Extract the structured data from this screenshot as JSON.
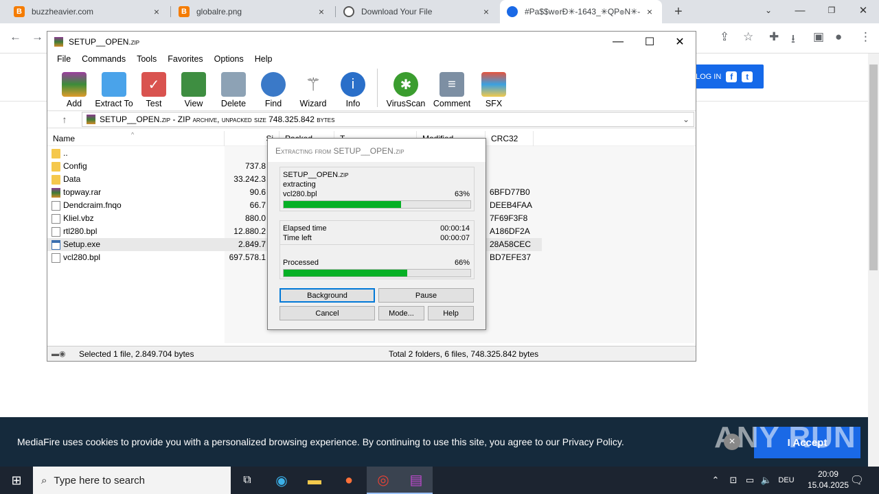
{
  "browser": {
    "tabs": [
      {
        "label": "buzzheavier.com",
        "favicon": "B",
        "color": "#f57c00"
      },
      {
        "label": "globalre.png",
        "favicon": "B",
        "color": "#f57c00"
      },
      {
        "label": "Download Your File",
        "favicon": "globe",
        "color": "#555555"
      },
      {
        "label": "#Pa$$w๏rÐ✳-1643_✳QP๏N✳-",
        "favicon": "mediafire",
        "color": "#1a69e6"
      }
    ],
    "new_tab": "+"
  },
  "website": {
    "login_label": "LOG IN",
    "cookie_text": "MediaFire uses cookies to provide you with a personalized browsing experience. By continuing to use this site, you agree to our Privacy Policy.",
    "accept_label": "I Accept",
    "watermark": "ANY RUN"
  },
  "winrar": {
    "title": "SETUP__OPEN.zip",
    "menu": [
      "File",
      "Commands",
      "Tools",
      "Favorites",
      "Options",
      "Help"
    ],
    "toolbar": [
      "Add",
      "Extract To",
      "Test",
      "View",
      "Delete",
      "Find",
      "Wizard",
      "Info",
      "VirusScan",
      "Comment",
      "SFX"
    ],
    "address": "SETUP__OPEN.zip - ZIP archive, unpacked size 748.325.842 bytes",
    "columns": {
      "name": "Name",
      "size": "Si",
      "packed": "Packed",
      "type": "T",
      "modified": "Modified",
      "crc": "CRC32"
    },
    "files": [
      {
        "name": "..",
        "size": "",
        "crc": "",
        "kind": "folder"
      },
      {
        "name": "Config",
        "size": "737.8",
        "crc": "",
        "kind": "folder"
      },
      {
        "name": "Data",
        "size": "33.242.3",
        "crc": "",
        "kind": "folder"
      },
      {
        "name": "topway.rar",
        "size": "90.6",
        "crc": "6BFD77B0",
        "kind": "rar"
      },
      {
        "name": "Dendcraim.fnqo",
        "size": "66.7",
        "crc": "DEEB4FAA",
        "kind": "file"
      },
      {
        "name": "Kliel.vbz",
        "size": "880.0",
        "crc": "7F69F3F8",
        "kind": "file"
      },
      {
        "name": "rtl280.bpl",
        "size": "12.880.2",
        "crc": "A186DF2A",
        "kind": "file"
      },
      {
        "name": "Setup.exe",
        "size": "2.849.7",
        "crc": "28A58CEC",
        "kind": "exe"
      },
      {
        "name": "vcl280.bpl",
        "size": "697.578.1",
        "crc": "BD7EFE37",
        "kind": "file"
      }
    ],
    "status_left": "Selected 1 file, 2.849.704 bytes",
    "status_right": "Total 2 folders, 6 files, 748.325.842 bytes"
  },
  "dialog": {
    "title": "Extracting from SETUP__OPEN.zip",
    "archive": "SETUP__OPEN.zip",
    "action": "extracting",
    "current_file": "vcl280.bpl",
    "file_percent_label": "63%",
    "file_progress": 0.63,
    "elapsed_label": "Elapsed time",
    "elapsed": "00:00:14",
    "left_label": "Time left",
    "left": "00:00:07",
    "processed_label": "Processed",
    "processed_percent_label": "66%",
    "processed_progress": 0.66,
    "buttons": {
      "background": "Background",
      "pause": "Pause",
      "cancel": "Cancel",
      "mode": "Mode...",
      "help": "Help"
    }
  },
  "taskbar": {
    "search_placeholder": "Type here to search",
    "time": "20:09",
    "date": "15.04.2025",
    "lang": "DEU"
  }
}
